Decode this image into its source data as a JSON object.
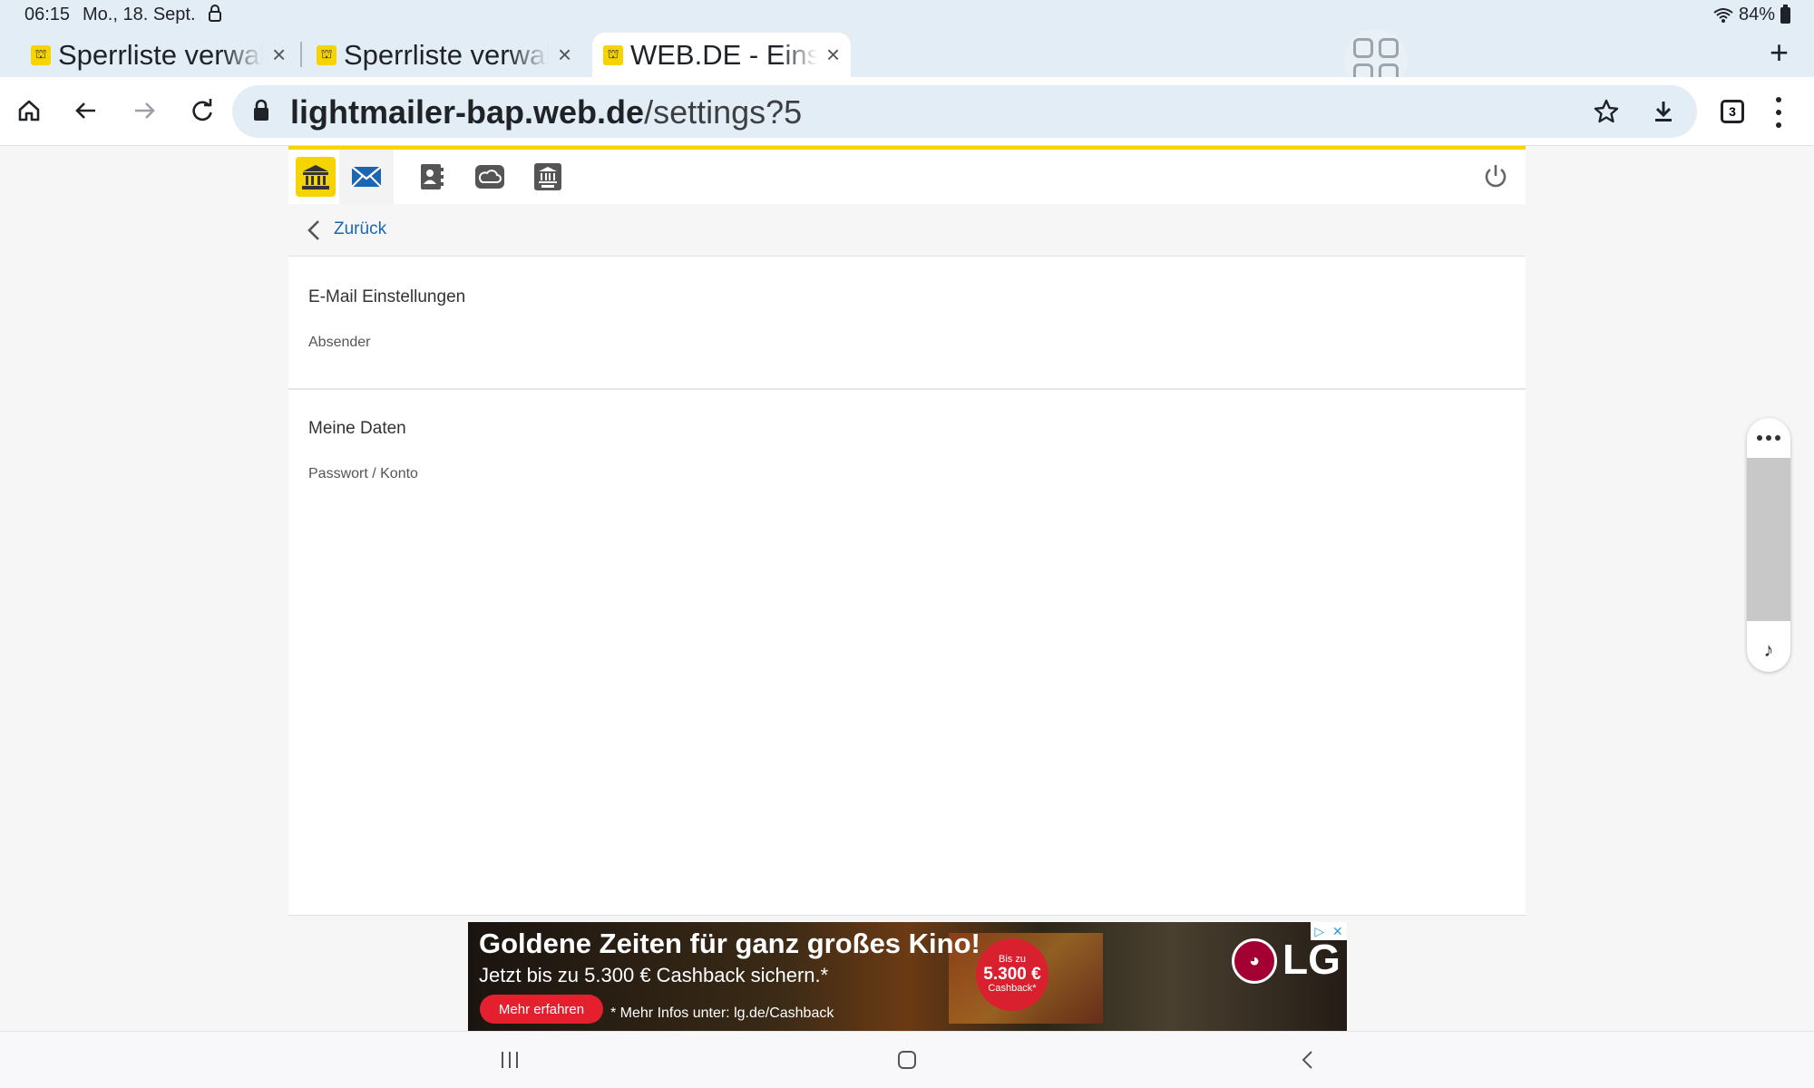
{
  "status_bar": {
    "time": "06:15",
    "date": "Mo., 18. Sept.",
    "battery": "84%"
  },
  "tabs": [
    {
      "title": "Sperrliste verwal",
      "active": false
    },
    {
      "title": "Sperrliste verwal",
      "active": false
    },
    {
      "title": "WEB.DE - Einste",
      "active": true
    }
  ],
  "tab_close_glyph": "×",
  "new_tab_glyph": "+",
  "toolbar": {
    "url_host": "lightmailer-bap.web.de",
    "url_path": "/settings?5",
    "tab_count": "3"
  },
  "app_nav": {
    "icons": [
      "webde-home-icon",
      "mail-icon",
      "contacts-icon",
      "cloud-icon",
      "club-icon"
    ],
    "accent_color": "#f6d400"
  },
  "back": {
    "label": "Zurück"
  },
  "sections": [
    {
      "title": "E-Mail Einstellungen",
      "link": "Absender"
    },
    {
      "title": "Meine Daten",
      "link": "Passwort / Konto"
    }
  ],
  "ad": {
    "headline": "Goldene Zeiten für ganz großes Kino!",
    "subline": "Jetzt bis zu 5.300 € Cashback sichern.*",
    "cta": "Mehr erfahren",
    "info": "* Mehr Infos unter: lg.de/Cashback",
    "badge_top": "Bis zu",
    "badge_amount": "5.300 €",
    "badge_bottom": "Cashback*",
    "brand": "LG",
    "brand_color": "#a50034"
  },
  "link_color": "#1a66b3"
}
